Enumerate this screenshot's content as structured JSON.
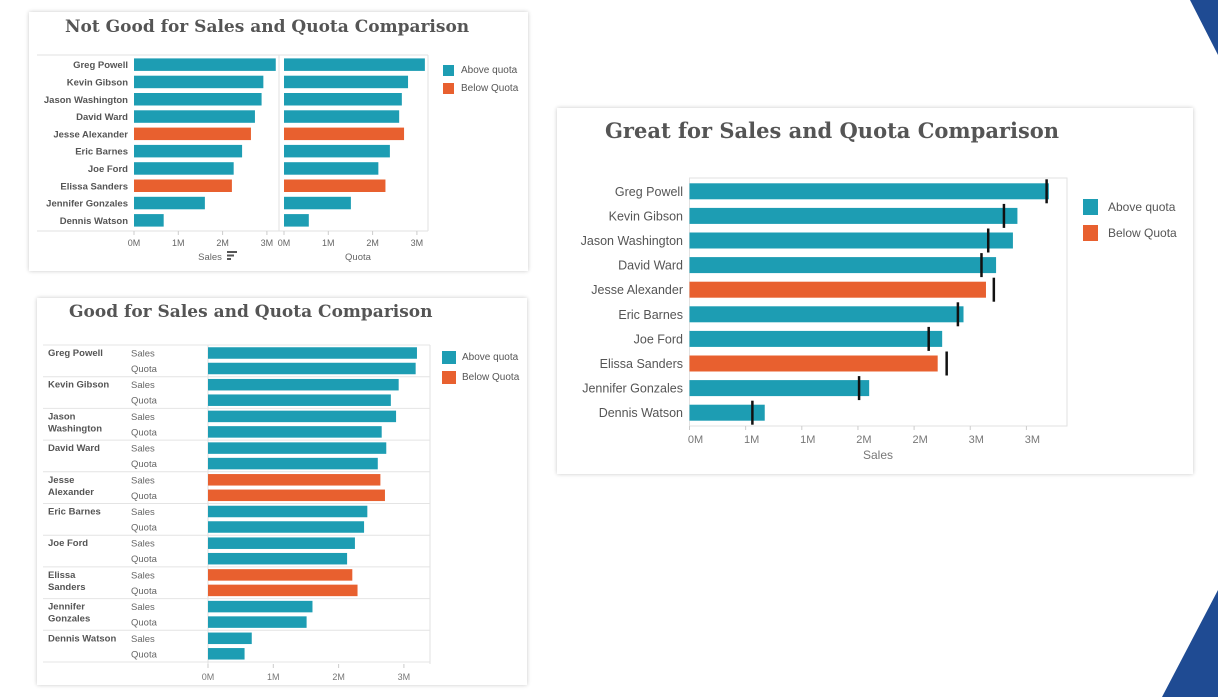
{
  "colors": {
    "above": "#1d9db3",
    "below": "#e8602f",
    "marker": "#111111",
    "decor": "#1f4b93"
  },
  "legend": {
    "above_label": "Above quota",
    "below_label": "Below Quota"
  },
  "charts": {
    "not_good": {
      "title": "Not Good for Sales and Quota Comparison",
      "sales_axis_label": "Sales",
      "quota_axis_label": "Quota",
      "sort_icon": "sort-descending-icon",
      "ticks": [
        "0M",
        "1M",
        "2M",
        "3M"
      ]
    },
    "good": {
      "title": "Good for Sales and Quota Comparison",
      "measure_labels": [
        "Sales",
        "Quota"
      ],
      "ticks": [
        "0M",
        "1M",
        "2M",
        "3M"
      ]
    },
    "great": {
      "title": "Great for Sales and Quota Comparison",
      "axis_label": "Sales",
      "ticks": [
        "0M",
        "1M",
        "1M",
        "2M",
        "2M",
        "3M",
        "3M"
      ]
    }
  },
  "chart_data": [
    {
      "type": "bar",
      "title": "Not Good for Sales and Quota Comparison",
      "orientation": "horizontal",
      "categories": [
        "Greg Powell",
        "Kevin Gibson",
        "Jason Washington",
        "David Ward",
        "Jesse Alexander",
        "Eric Barnes",
        "Joe Ford",
        "Elissa Sanders",
        "Jennifer Gonzales",
        "Dennis Watson"
      ],
      "series": [
        {
          "name": "Sales",
          "values": [
            3.2,
            2.92,
            2.88,
            2.73,
            2.64,
            2.44,
            2.25,
            2.21,
            1.6,
            0.67
          ]
        },
        {
          "name": "Quota",
          "values": [
            3.18,
            2.8,
            2.66,
            2.6,
            2.71,
            2.39,
            2.13,
            2.29,
            1.51,
            0.56
          ]
        }
      ],
      "status": [
        "Above quota",
        "Above quota",
        "Above quota",
        "Above quota",
        "Below Quota",
        "Above quota",
        "Above quota",
        "Below Quota",
        "Above quota",
        "Above quota"
      ],
      "xlabels": [
        "Sales",
        "Quota"
      ],
      "xticks": [
        "0M",
        "1M",
        "2M",
        "3M"
      ],
      "xlim": [
        0,
        3.3
      ],
      "legend": [
        "Above quota",
        "Below Quota"
      ],
      "legend_position": "right"
    },
    {
      "type": "bar",
      "title": "Good for Sales and Quota Comparison",
      "orientation": "horizontal",
      "categories": [
        "Greg Powell",
        "Kevin Gibson",
        "Jason Washington",
        "David Ward",
        "Jesse Alexander",
        "Eric Barnes",
        "Joe Ford",
        "Elissa Sanders",
        "Jennifer Gonzales",
        "Dennis Watson"
      ],
      "series": [
        {
          "name": "Sales",
          "values": [
            3.2,
            2.92,
            2.88,
            2.73,
            2.64,
            2.44,
            2.25,
            2.21,
            1.6,
            0.67
          ]
        },
        {
          "name": "Quota",
          "values": [
            3.18,
            2.8,
            2.66,
            2.6,
            2.71,
            2.39,
            2.13,
            2.29,
            1.51,
            0.56
          ]
        }
      ],
      "status": [
        "Above quota",
        "Above quota",
        "Above quota",
        "Above quota",
        "Below Quota",
        "Above quota",
        "Above quota",
        "Below Quota",
        "Above quota",
        "Above quota"
      ],
      "xticks": [
        "0M",
        "1M",
        "2M",
        "3M"
      ],
      "xlim": [
        0,
        3.4
      ],
      "legend": [
        "Above quota",
        "Below Quota"
      ],
      "legend_position": "right"
    },
    {
      "type": "bar",
      "subtype": "bullet",
      "title": "Great for Sales and Quota Comparison",
      "orientation": "horizontal",
      "categories": [
        "Greg Powell",
        "Kevin Gibson",
        "Jason Washington",
        "David Ward",
        "Jesse Alexander",
        "Eric Barnes",
        "Joe Ford",
        "Elissa Sanders",
        "Jennifer Gonzales",
        "Dennis Watson"
      ],
      "series": [
        {
          "name": "Sales",
          "values": [
            3.2,
            2.92,
            2.88,
            2.73,
            2.64,
            2.44,
            2.25,
            2.21,
            1.6,
            0.67
          ]
        },
        {
          "name": "Quota",
          "mark": "reference-line",
          "values": [
            3.18,
            2.8,
            2.66,
            2.6,
            2.71,
            2.39,
            2.13,
            2.29,
            1.51,
            0.56
          ]
        }
      ],
      "status": [
        "Above quota",
        "Above quota",
        "Above quota",
        "Above quota",
        "Below Quota",
        "Above quota",
        "Above quota",
        "Below Quota",
        "Above quota",
        "Above quota"
      ],
      "xlabel": "Sales",
      "xticks": [
        "0M",
        "1M",
        "1M",
        "2M",
        "2M",
        "3M",
        "3M"
      ],
      "xtick_values": [
        0,
        0.5,
        1.0,
        1.5,
        2.0,
        2.5,
        3.0
      ],
      "xlim": [
        0,
        3.35
      ],
      "legend": [
        "Above quota",
        "Below Quota"
      ],
      "legend_position": "right"
    }
  ]
}
